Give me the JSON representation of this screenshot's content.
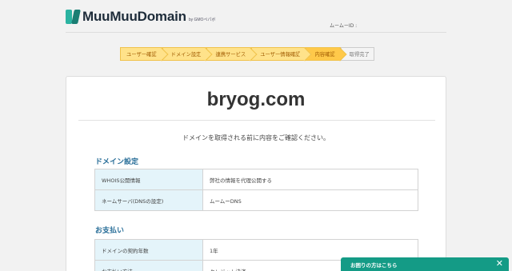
{
  "header": {
    "logo_text": "MuuMuuDomain",
    "logo_sub": "by GMOペパボ",
    "member_id_label": "ムームーID :"
  },
  "steps": [
    "ユーザー確認",
    "ドメイン設定",
    "連携サービス",
    "ユーザー情報確認",
    "内容確認",
    "取得完了"
  ],
  "main": {
    "domain_name": "bryog.com",
    "confirm_message": "ドメインを取得される前に内容をご確認ください。",
    "domain_section": {
      "title": "ドメイン設定",
      "rows": [
        {
          "label": "WHOIS公開情報",
          "value": "弊社の情報を代理公開する"
        },
        {
          "label": "ネームサーバ(DNSの設定)",
          "value": "ムームーDNS"
        }
      ]
    },
    "payment_section": {
      "title": "お支払い",
      "rows": [
        {
          "label": "ドメインの契約年数",
          "value": "1年"
        },
        {
          "label": "お支払い方法",
          "value": "クレジット決済"
        }
      ]
    }
  },
  "helpbar": {
    "label": "お困りの方はこちら",
    "close_glyph": "✕"
  },
  "colors": {
    "accent_teal": "#149b86",
    "step_active": "#ffc94a",
    "section_title": "#2a6f99"
  }
}
